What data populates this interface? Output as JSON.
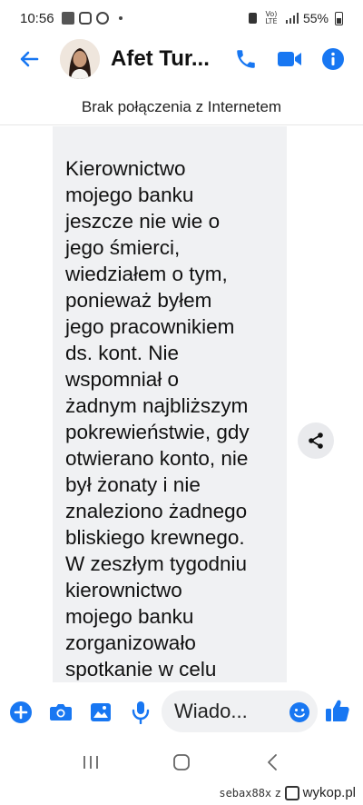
{
  "status_bar": {
    "time": "10:56",
    "network_label": "Vo) LTE",
    "battery": "55%"
  },
  "header": {
    "contact_name": "Afet Tur...",
    "icons": [
      "back-arrow-icon",
      "phone-icon",
      "video-call-icon",
      "info-icon"
    ]
  },
  "banner": {
    "text": "Brak połączenia z Internetem"
  },
  "message": {
    "text": "Kierownictwo\nmojego banku\njeszcze nie wie o\njego śmierci,\nwiedziałem o tym,\nponieważ byłem\njego pracownikiem\nds. kont. Nie\nwspomniał o\nżadnym najbliższym\npokrewieństwie, gdy\notwierano konto, nie\nbył żonaty i nie\nznaleziono żadnego\nbliskiego krewnego.\nW zeszłym tygodniu\nkierownictwo\nmojego banku\nzorganizowało\nspotkanie w celu"
  },
  "composer": {
    "placeholder": "Wiado...",
    "icons": [
      "plus-icon",
      "camera-icon",
      "gallery-icon",
      "microphone-icon",
      "emoji-icon",
      "thumbs-up-icon"
    ]
  },
  "colors": {
    "accent": "#1877f2",
    "bubble_bg": "#f0f1f3"
  },
  "watermark": {
    "user": "sebax88x",
    "z": "z",
    "site": "wykop.pl"
  }
}
